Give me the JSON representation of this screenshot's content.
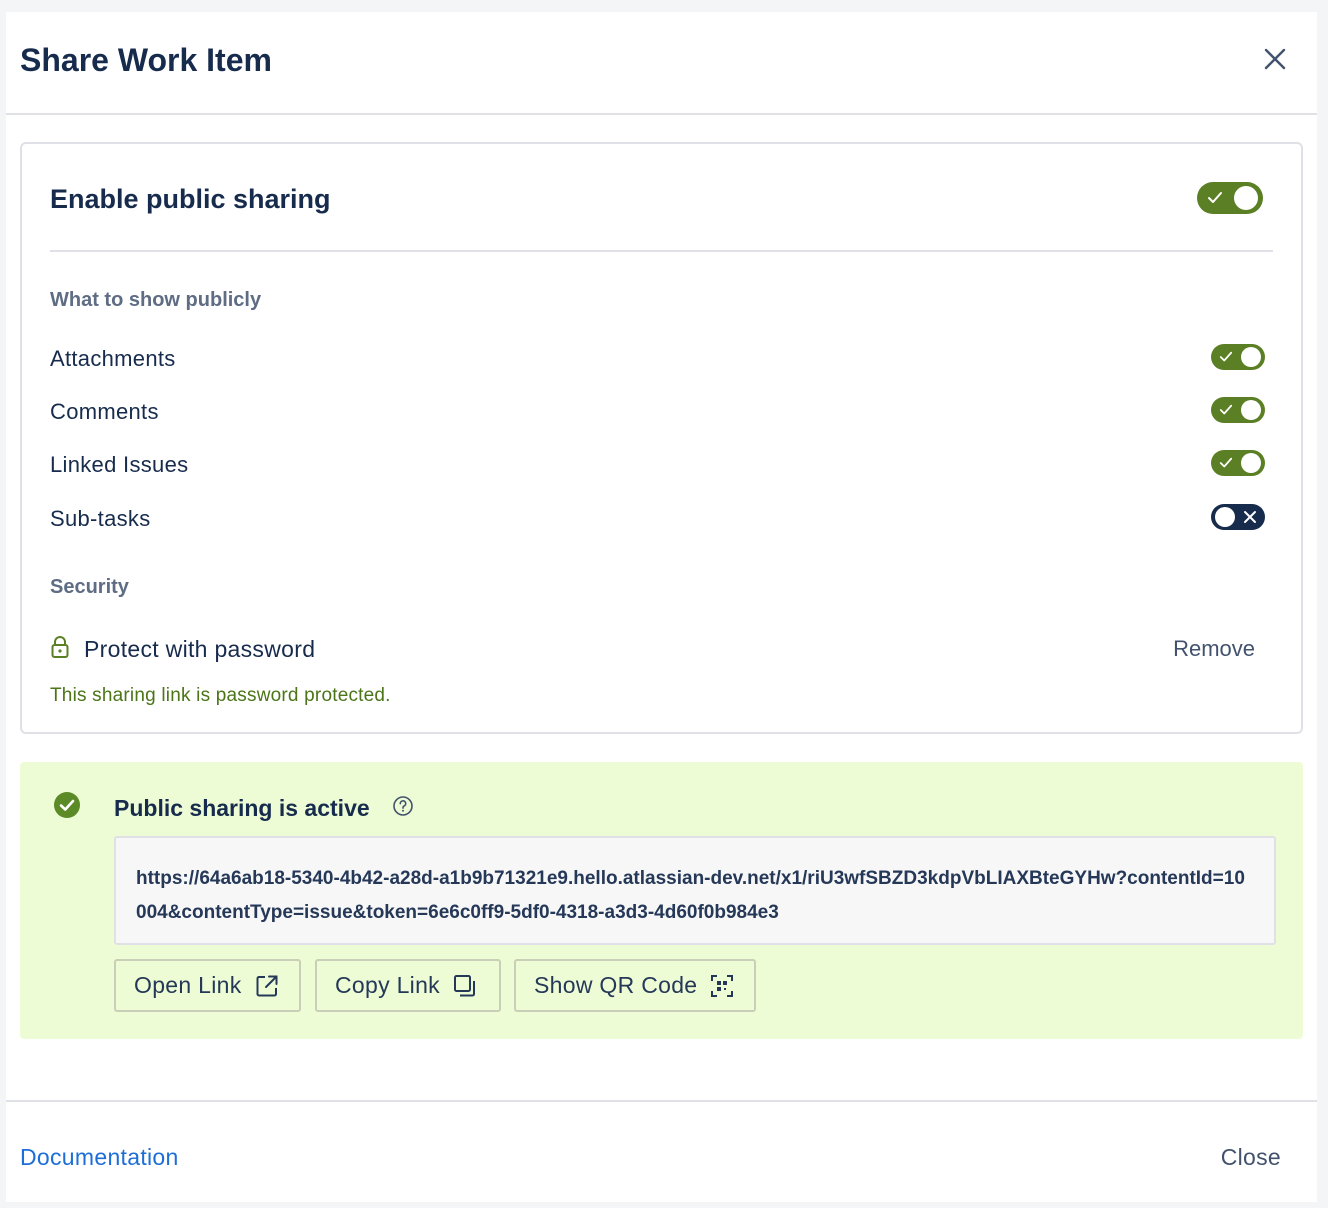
{
  "dialog": {
    "title": "Share Work Item"
  },
  "sharing": {
    "enable_label": "Enable public sharing",
    "enabled": true,
    "what_to_show_label": "What to show publicly",
    "options": [
      {
        "label": "Attachments",
        "enabled": true
      },
      {
        "label": "Comments",
        "enabled": true
      },
      {
        "label": "Linked Issues",
        "enabled": true
      },
      {
        "label": "Sub-tasks",
        "enabled": false
      }
    ],
    "security_label": "Security",
    "password_label": "Protect with password",
    "remove_label": "Remove",
    "password_note": "This sharing link is password protected."
  },
  "active": {
    "title": "Public sharing is active",
    "url": "https://64a6ab18-5340-4b42-a28d-a1b9b71321e9.hello.atlassian-dev.net/x1/riU3wfSBZD3kdpVbLIAXBteGYHw?contentId=10004&contentType=issue&token=6e6c0ff9-5df0-4318-a3d3-4d60f0b984e3",
    "buttons": {
      "open_link": "Open Link",
      "copy_link": "Copy Link",
      "show_qr": "Show QR Code"
    }
  },
  "footer": {
    "documentation_label": "Documentation",
    "close_label": "Close"
  },
  "icons": {
    "close": "close-icon",
    "check": "check-icon",
    "cross": "cross-icon",
    "lock": "lock-icon",
    "check_circle": "check-circle-icon",
    "help": "help-icon",
    "external": "external-link-icon",
    "copy": "copy-icon",
    "qr": "qr-code-icon"
  },
  "colors": {
    "toggle_on": "#5b7f24",
    "toggle_off": "#172b4d",
    "success_bg": "#eefcd5",
    "success_text": "#4b7518",
    "link": "#1d6ed6"
  }
}
